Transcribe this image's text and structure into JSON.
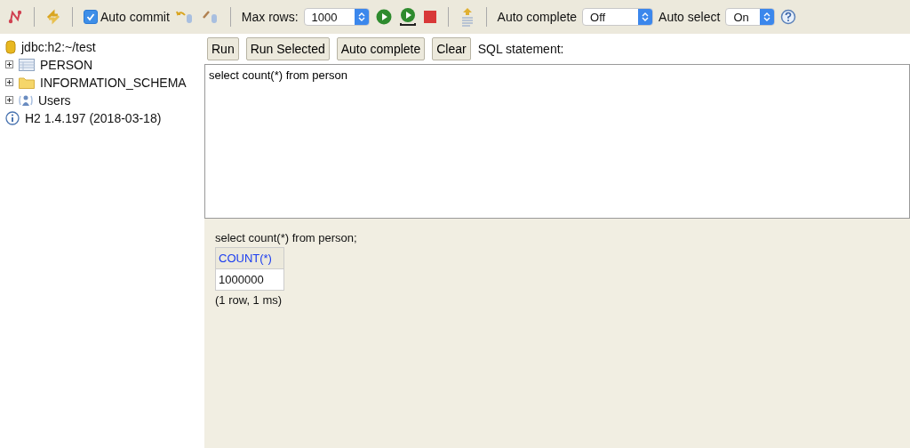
{
  "toolbar": {
    "auto_commit": {
      "label": "Auto commit",
      "checked": true
    },
    "max_rows": {
      "label": "Max rows:",
      "value": "1000"
    },
    "auto_complete": {
      "label": "Auto complete",
      "value": "Off"
    },
    "auto_select": {
      "label": "Auto select",
      "value": "On"
    }
  },
  "tree": [
    {
      "kind": "connection",
      "label": "jdbc:h2:~/test",
      "expandable": false
    },
    {
      "kind": "table",
      "label": "PERSON",
      "expandable": true
    },
    {
      "kind": "schema",
      "label": "INFORMATION_SCHEMA",
      "expandable": true
    },
    {
      "kind": "users",
      "label": "Users",
      "expandable": true
    },
    {
      "kind": "info",
      "label": "H2 1.4.197 (2018-03-18)",
      "expandable": false
    }
  ],
  "buttons": [
    "Run",
    "Run Selected",
    "Auto complete",
    "Clear"
  ],
  "sql_label": "SQL statement:",
  "editor": {
    "value": "select count(*) from person"
  },
  "result": {
    "statement": "select count(*) from person;",
    "columns": [
      "COUNT(*)"
    ],
    "rows": [
      [
        "1000000"
      ]
    ],
    "summary": "(1 row, 1 ms)"
  }
}
